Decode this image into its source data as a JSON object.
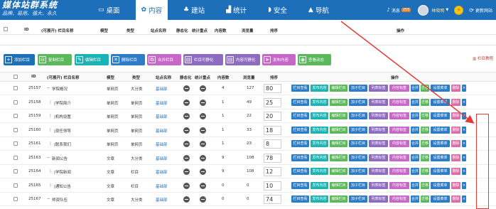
{
  "app": {
    "title": "媒体站群系统",
    "subtitle": "品牌、易用、强大、永久"
  },
  "nav": [
    {
      "icon": "monitor-icon",
      "label": "桌面"
    },
    {
      "icon": "gear-icon",
      "label": "内容"
    },
    {
      "icon": "tree-icon",
      "label": "建站"
    },
    {
      "icon": "chart-icon",
      "label": "统计"
    },
    {
      "icon": "shield-icon",
      "label": "安全"
    },
    {
      "icon": "navigation-icon",
      "label": "导航"
    }
  ],
  "topright": {
    "messages_label": "消息",
    "messages_count": "255",
    "username": "林晓明",
    "refresh_label": "更新网站"
  },
  "sticky_header": {
    "id": "ID",
    "name": "(可展开) 栏目名称",
    "model": "模型",
    "type": "类型",
    "site": "站点名称",
    "static": "静态化",
    "stat": "统计重点",
    "content": "内容数",
    "views": "浏览量",
    "sort": "排序",
    "ops": "操作"
  },
  "toolbar": {
    "add": "添加栏目",
    "copy": "复制栏目",
    "edit": "编辑栏目",
    "delete": "删除栏目",
    "merge": "合并栏目",
    "static_cat": "栏目可静化",
    "static_content": "内容可静化",
    "publish": "发布内容",
    "dynamic": "查看动态",
    "help": "栏目教程"
  },
  "table": {
    "headers": {
      "id": "ID",
      "name": "(可展开) 栏目名称",
      "model": "模型",
      "type": "类型",
      "site": "站点名称",
      "static": "静态化",
      "stat": "统计重点",
      "content": "内容数",
      "views": "浏览量",
      "sort": "排序",
      "ops": "操作"
    },
    "rows": [
      {
        "id": "25157",
        "prefix": "",
        "expand": "−",
        "name": "学院概况",
        "model": "单网页",
        "type": "大分类",
        "site": "基础部",
        "content": "4",
        "views": "127",
        "sort": "80"
      },
      {
        "id": "25158",
        "prefix": "|",
        "expand": "",
        "name": "|学院简介",
        "model": "单网页",
        "type": "单网页",
        "site": "基础部",
        "content": "1",
        "views": "49",
        "sort": "25"
      },
      {
        "id": "25159",
        "prefix": "|",
        "expand": "",
        "name": "|机构设置",
        "model": "单网页",
        "type": "单网页",
        "site": "基础部",
        "content": "1",
        "views": "22",
        "sort": "20"
      },
      {
        "id": "25160",
        "prefix": "|",
        "expand": "",
        "name": "|现任领导",
        "model": "单网页",
        "type": "单网页",
        "site": "基础部",
        "content": "1",
        "views": "33",
        "sort": "18"
      },
      {
        "id": "25161",
        "prefix": "|",
        "expand": "",
        "name": "|联系我们",
        "model": "单网页",
        "type": "单网页",
        "site": "基础部",
        "content": "1",
        "views": "23",
        "sort": "8"
      },
      {
        "id": "25163",
        "prefix": "",
        "expand": "−",
        "name": "新闻公告",
        "model": "文章",
        "type": "大分类",
        "site": "基础部",
        "content": "9",
        "views": "108",
        "sort": "78"
      },
      {
        "id": "25164",
        "prefix": "|",
        "expand": "",
        "name": "|学院新闻",
        "model": "文章",
        "type": "栏目",
        "site": "基础部",
        "content": "9",
        "views": "108",
        "sort": "12"
      },
      {
        "id": "25165",
        "prefix": "|",
        "expand": "",
        "name": "|通知公告",
        "model": "文章",
        "type": "栏目",
        "site": "基础部",
        "content": "0",
        "views": "0",
        "sort": "10"
      },
      {
        "id": "25167",
        "prefix": "",
        "expand": "−",
        "name": "师资队伍",
        "model": "文章",
        "type": "大分类",
        "site": "基础部",
        "content": "0",
        "views": "0",
        "sort": "74"
      }
    ]
  },
  "row_ops": [
    {
      "label": "栏目查看",
      "color": "#2d7cc7"
    },
    {
      "label": "发布内容",
      "color": "#1bb3b3"
    },
    {
      "label": "编辑栏目",
      "color": "#5cb85c"
    },
    {
      "label": "加子栏目",
      "color": "#2d7cc7"
    },
    {
      "label": "列表标签",
      "color": "#8e6bbf"
    },
    {
      "label": "内容标签",
      "color": "#c767c7"
    },
    {
      "label": "合并",
      "color": "#2d7cc7"
    },
    {
      "label": "迁移",
      "color": "#5cb85c"
    },
    {
      "label": "设置菜单",
      "color": "#2d7cc7"
    },
    {
      "label": "删除",
      "color": "#e06aa8"
    },
    {
      "label": "×",
      "color": "#2d7cc7"
    }
  ],
  "colors": {
    "topbar": "#1e6fb9",
    "highlight": "#e53935"
  }
}
